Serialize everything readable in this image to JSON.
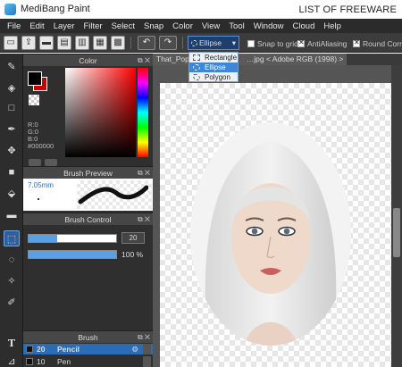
{
  "titlebar": {
    "app_name": "MediBang Paint",
    "watermark": "LIST OF FREEWARE"
  },
  "menu": [
    "File",
    "Edit",
    "Layer",
    "Filter",
    "Select",
    "Snap",
    "Color",
    "View",
    "Tool",
    "Window",
    "Cloud",
    "Help"
  ],
  "toolbar": {
    "selection_shape": "Ellipse",
    "snap_to_grid": "Snap to grid",
    "anti_aliasing": "AntiAliasing",
    "round_corners": "Round Corne",
    "snap_checked": false,
    "aa_checked": true,
    "round_checked": true
  },
  "shape_menu": {
    "options": [
      "Rectangle",
      "Ellipse",
      "Polygon"
    ],
    "highlighted": "Ellipse"
  },
  "color_panel": {
    "title": "Color",
    "r_label": "R:0",
    "g_label": "G:0",
    "b_label": "B:0",
    "hex": "#000000",
    "foreground": "#000000",
    "background": "#cc0000"
  },
  "brush_preview": {
    "title": "Brush Preview",
    "size": "7.05mm"
  },
  "brush_control": {
    "title": "Brush Control",
    "size_value": "20",
    "size_fraction": 0.33,
    "opacity_value": "100 %",
    "opacity_fraction": 1.0
  },
  "brush_list": {
    "title": "Brush",
    "items": [
      {
        "size": "20",
        "name": "Pencil",
        "selected": true
      },
      {
        "size": "10",
        "name": "Pen",
        "selected": false
      }
    ]
  },
  "document": {
    "tab_title": "That_Poppy…",
    "tab_suffix": "…jpg < Adobe RGB (1998) >"
  },
  "icons": {
    "title_logo": "medibang-logo",
    "tools": [
      "brush-icon",
      "eraser-icon",
      "rect-icon",
      "pen-icon",
      "move-icon",
      "fill-rect-icon",
      "bucket-icon",
      "gradient-icon",
      "select-rect-icon",
      "lasso-icon",
      "magic-wand-icon",
      "select-pen-icon",
      "text-icon",
      "eyedropper-icon"
    ]
  }
}
